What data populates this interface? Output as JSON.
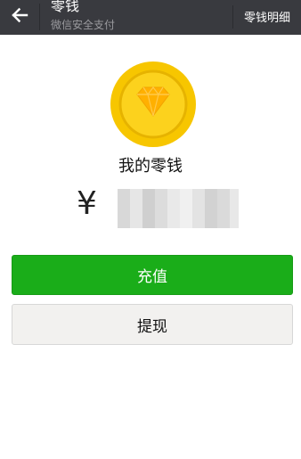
{
  "header": {
    "back_icon": "arrow-left-icon",
    "title": "零钱",
    "subtitle": "微信安全支付",
    "detail_link": "零钱明细"
  },
  "wallet": {
    "icon": "diamond-coin-icon",
    "title": "我的零钱",
    "currency_symbol": "¥"
  },
  "actions": {
    "recharge_label": "充值",
    "withdraw_label": "提现"
  },
  "colors": {
    "header_bg": "#393a3f",
    "primary_green": "#1aad19",
    "coin_gold": "#f7c600",
    "secondary_button_bg": "#f2f1ef"
  }
}
